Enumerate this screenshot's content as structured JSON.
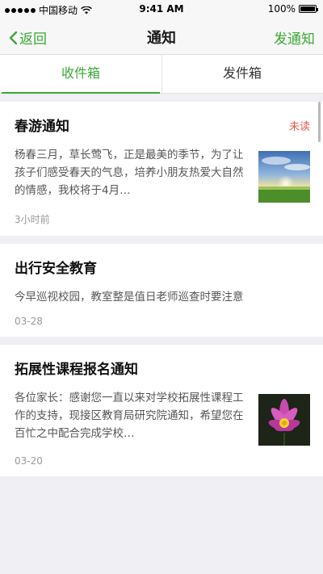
{
  "status_bar": {
    "carrier": "中国移动",
    "time": "9:41 AM",
    "battery": "100%",
    "battery_level": 1.0
  },
  "nav": {
    "back_label": "返回",
    "title": "通知",
    "action_label": "发通知",
    "accent_color": "#3aa935"
  },
  "tabs": [
    {
      "label": "收件箱",
      "active": true
    },
    {
      "label": "发件箱",
      "active": false
    }
  ],
  "notices": [
    {
      "title": "春游通知",
      "badge": "未读",
      "body": "杨春三月，草长莺飞，正是最美的季节，为了让孩子们感受春天的气息，培养小朋友热爱大自然的情感，我校将于4月…",
      "time": "3小时前",
      "thumb": "landscape-sunset-image"
    },
    {
      "title": "出行安全教育",
      "badge": "",
      "body": "今早巡视校园，教室整是值日老师巡查时要注意",
      "time": "03-28",
      "thumb": ""
    },
    {
      "title": "拓展性课程报名通知",
      "badge": "",
      "body": "各位家长：感谢您一直以来对学校拓展性课程工作的支持，现接区教育局研究院通知，希望您在百忙之中配合完成学校…",
      "time": "03-20",
      "thumb": "lotus-flower-image"
    }
  ]
}
